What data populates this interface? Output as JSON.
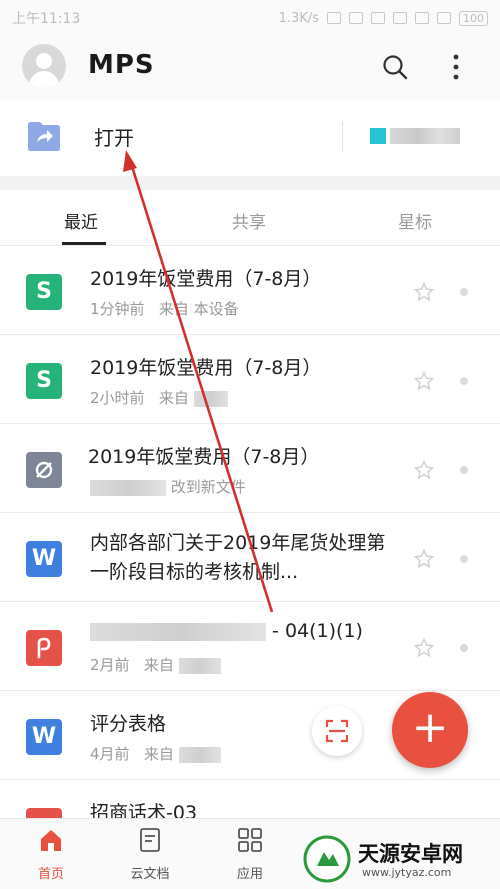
{
  "status": {
    "time": "上午11:13",
    "speed": "1.3K/s",
    "battery": "100"
  },
  "app": {
    "logo": "MPS"
  },
  "open_card": {
    "label": "打开"
  },
  "tabs": [
    {
      "label": "最近"
    },
    {
      "label": "共享"
    },
    {
      "label": "星标"
    }
  ],
  "files": [
    {
      "title": "2019年饭堂费用（7-8月）",
      "meta_time": "1分钟前",
      "meta_source": "来自 本设备",
      "icon": "S",
      "icon_color": "#26b37a"
    },
    {
      "title": "2019年饭堂费用（7-8月）",
      "meta_time": "2小时前",
      "meta_source": "来自",
      "icon": "S",
      "icon_color": "#26b37a"
    },
    {
      "title": "2019年饭堂费用（7-8月）",
      "meta_time": "",
      "meta_source": "改到新文件",
      "icon": "doc-link",
      "icon_color": "#7d8597"
    },
    {
      "title": "内部各部门关于2019年尾货处理第一阶段目标的考核机制...",
      "meta_time": "",
      "meta_source": "",
      "icon": "W",
      "icon_color": "#3f7fe0"
    },
    {
      "title": "- 04(1)(1)",
      "meta_time": "2月前",
      "meta_source": "来自",
      "icon": "P",
      "icon_color": "#e4524a"
    },
    {
      "title": "评分表格",
      "meta_time": "4月前",
      "meta_source": "来自",
      "icon": "W",
      "icon_color": "#3f7fe0"
    },
    {
      "title": "招商话术-03",
      "meta_time": "",
      "meta_source": "",
      "icon": "",
      "icon_color": "#e4524a"
    }
  ],
  "fab": {
    "add": "+"
  },
  "nav": [
    {
      "label": "首页"
    },
    {
      "label": "云文档"
    },
    {
      "label": "应用"
    }
  ],
  "watermark": {
    "text": "天源安卓网",
    "url": "www.jytyaz.com"
  },
  "colors": {
    "accent": "#e8513f",
    "annotation_arrow": "#d0312d"
  }
}
